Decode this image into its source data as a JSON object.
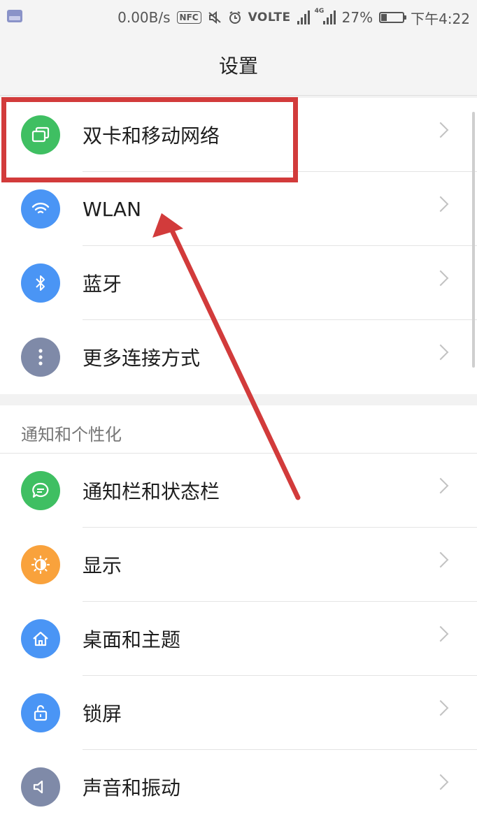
{
  "status_bar": {
    "net_speed": "0.00B/s",
    "nfc": "NFC",
    "volte": "VOLTE",
    "network_type": "4G",
    "battery_percent": "27%",
    "battery_level": 0.27,
    "time": "下午4:22"
  },
  "header": {
    "title": "设置"
  },
  "connectivity": {
    "items": [
      {
        "label": "双卡和移动网络",
        "icon": "sim-card-icon",
        "color": "#3fbf62"
      },
      {
        "label": "WLAN",
        "icon": "wifi-icon",
        "color": "#4a95f5"
      },
      {
        "label": "蓝牙",
        "icon": "bluetooth-icon",
        "color": "#4a95f5"
      },
      {
        "label": "更多连接方式",
        "icon": "more-dots-icon",
        "color": "#7f8aa8"
      }
    ]
  },
  "personalization": {
    "header": "通知和个性化",
    "items": [
      {
        "label": "通知栏和状态栏",
        "icon": "message-icon",
        "color": "#3fbf62"
      },
      {
        "label": "显示",
        "icon": "brightness-icon",
        "color": "#f9a23c"
      },
      {
        "label": "桌面和主题",
        "icon": "home-icon",
        "color": "#4a95f5"
      },
      {
        "label": "锁屏",
        "icon": "lock-icon",
        "color": "#4a95f5"
      },
      {
        "label": "声音和振动",
        "icon": "speaker-icon",
        "color": "#7f8aa8"
      }
    ]
  },
  "annotation_color": "#d23b3b"
}
